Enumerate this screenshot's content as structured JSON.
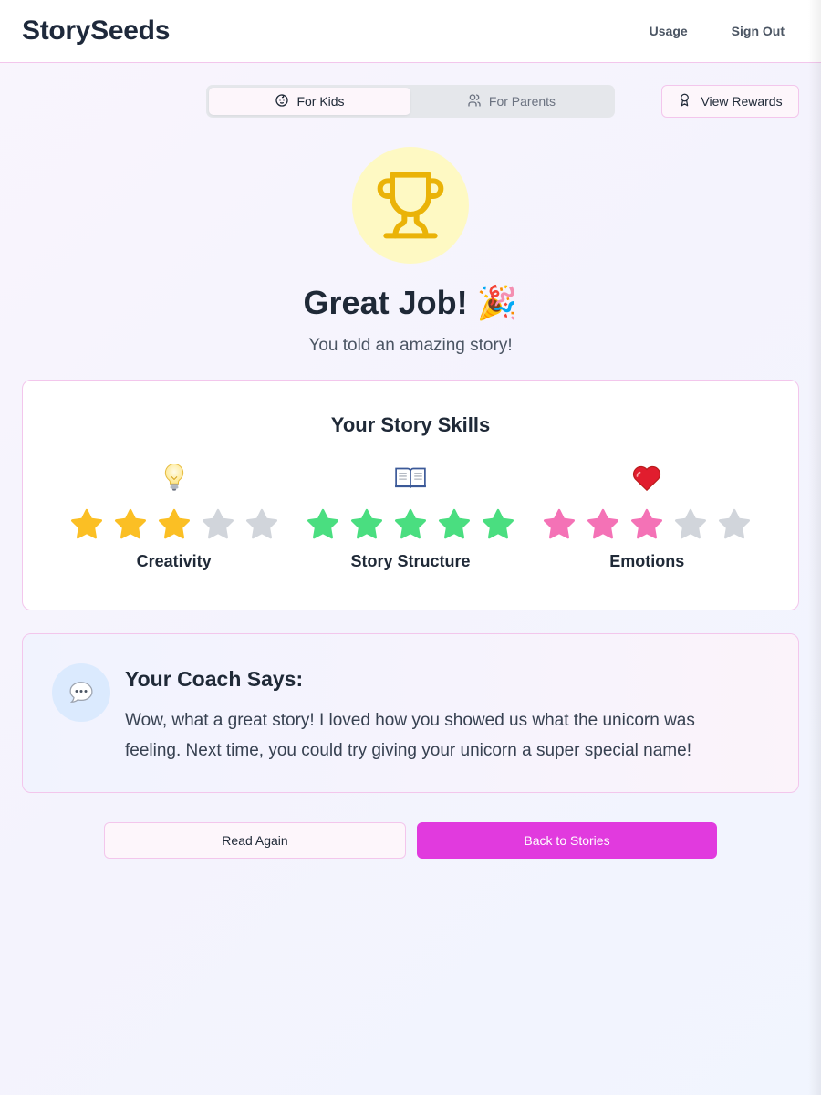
{
  "header": {
    "brand": "StorySeeds",
    "nav": {
      "usage": "Usage",
      "sign_out": "Sign Out"
    }
  },
  "tabs": {
    "kids": "For Kids",
    "parents": "For Parents",
    "active": "kids"
  },
  "rewards_button": "View Rewards",
  "hero": {
    "title": "Great Job!",
    "title_emoji": "🎉",
    "subtitle": "You told an amazing story!"
  },
  "skills": {
    "title": "Your Story Skills",
    "items": [
      {
        "label": "Creativity",
        "icon": "lightbulb-icon",
        "rating": 3,
        "max": 5,
        "color": "#fbbf24"
      },
      {
        "label": "Story Structure",
        "icon": "open-book-icon",
        "rating": 5,
        "max": 5,
        "color": "#4ade80"
      },
      {
        "label": "Emotions",
        "icon": "heart-icon",
        "rating": 3,
        "max": 5,
        "color": "#f472b6"
      }
    ],
    "empty_star_color": "#d1d5db"
  },
  "coach": {
    "title": "Your Coach Says:",
    "message": "Wow, what a great story! I loved how you showed us what the unicorn was feeling. Next time, you could try giving your unicorn a super special name!"
  },
  "actions": {
    "read_again": "Read Again",
    "back_to_stories": "Back to Stories"
  },
  "colors": {
    "accent": "#e13ade",
    "border_pink": "#f3c6ec",
    "trophy": "#eab308",
    "trophy_bg": "#fef9c3"
  }
}
